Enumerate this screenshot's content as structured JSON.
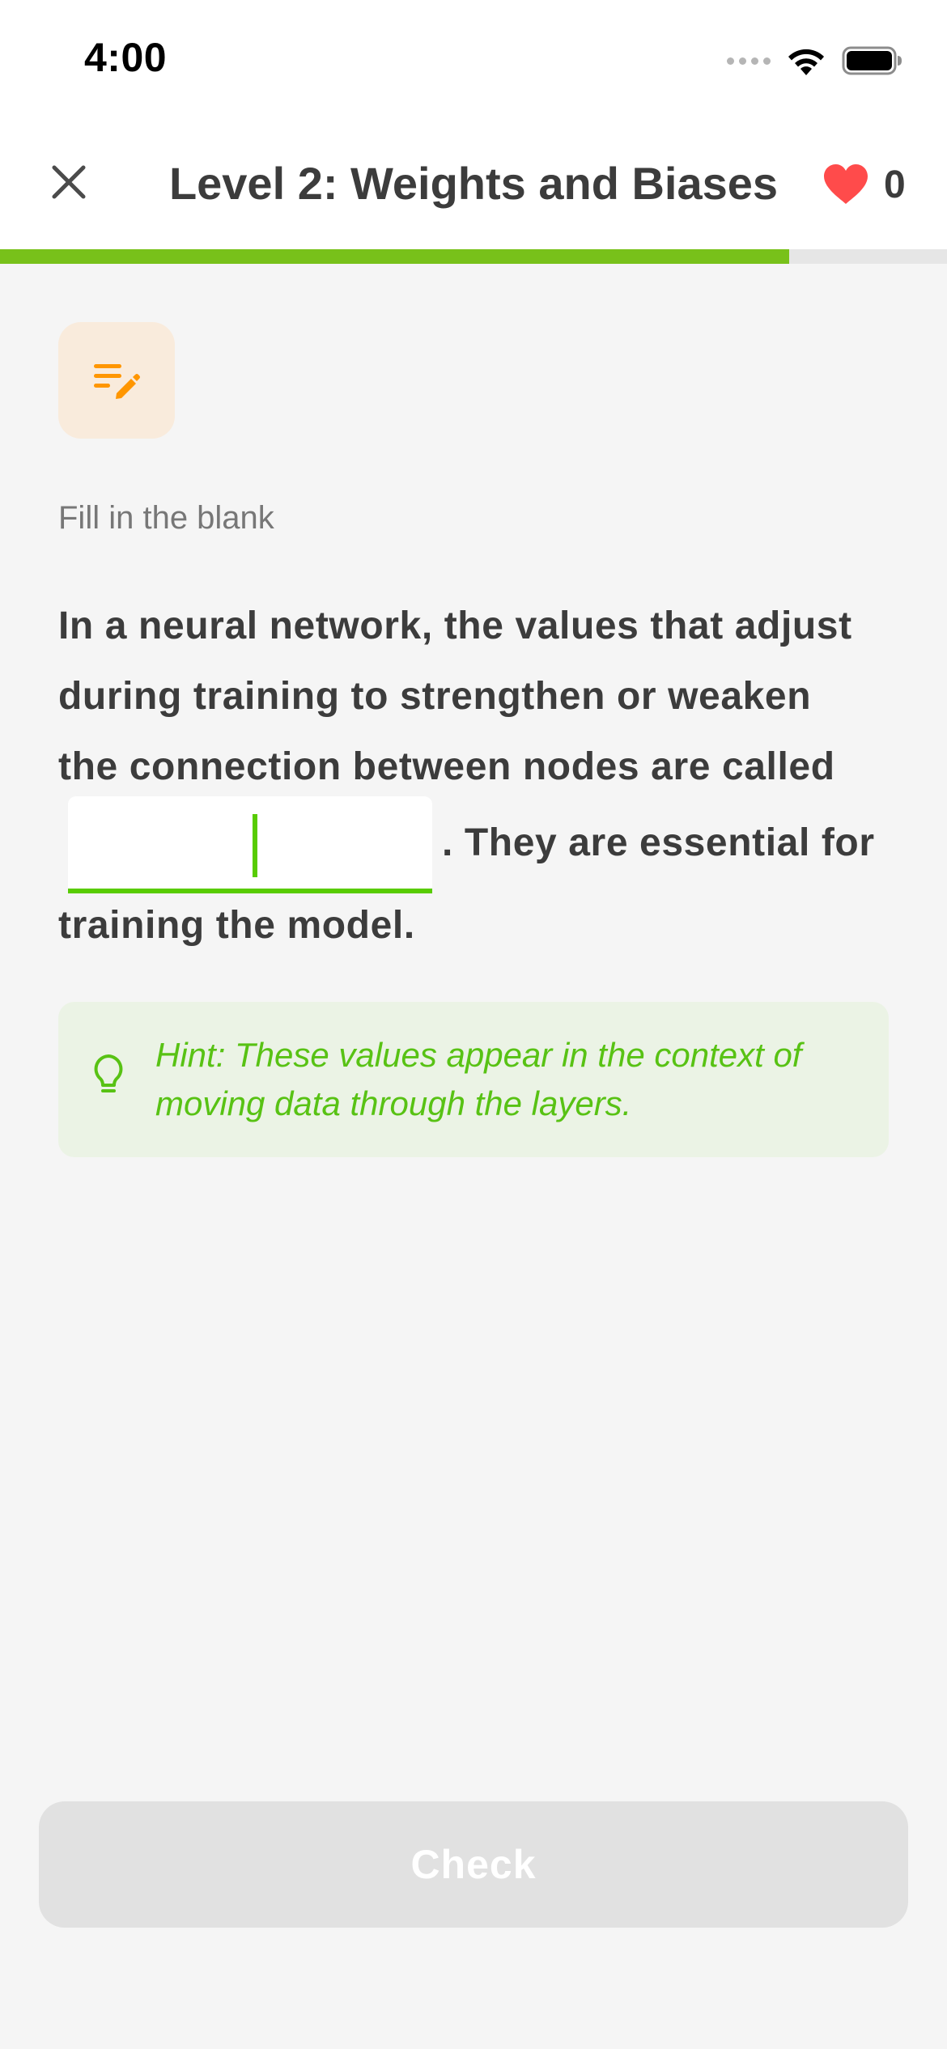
{
  "status_bar": {
    "time": "4:00"
  },
  "header": {
    "title": "Level 2: Weights and Biases",
    "hearts_count": "0"
  },
  "progress": {
    "fraction": 0.833
  },
  "exercise": {
    "type_label": "Fill in the blank",
    "question_lines": [
      "In a neural network, the values that adjust",
      "during training to strengthen or weaken",
      "the connection between nodes are called"
    ],
    "after_blank": ". They are essential for",
    "last_line": "training the model.",
    "blank_value": "",
    "hint": "Hint: These values appear in the context of moving data through the layers."
  },
  "buttons": {
    "check_label": "Check"
  },
  "colors": {
    "accent_green": "#58cc02",
    "progress_green": "#78c11a",
    "heart_red": "#ff4b4b",
    "icon_orange": "#ff9600",
    "button_disabled": "#e1e1e1"
  },
  "icons": {
    "close": "close-icon",
    "heart": "heart-icon",
    "exercise": "edit-list-icon",
    "hint": "lightbulb-icon"
  }
}
